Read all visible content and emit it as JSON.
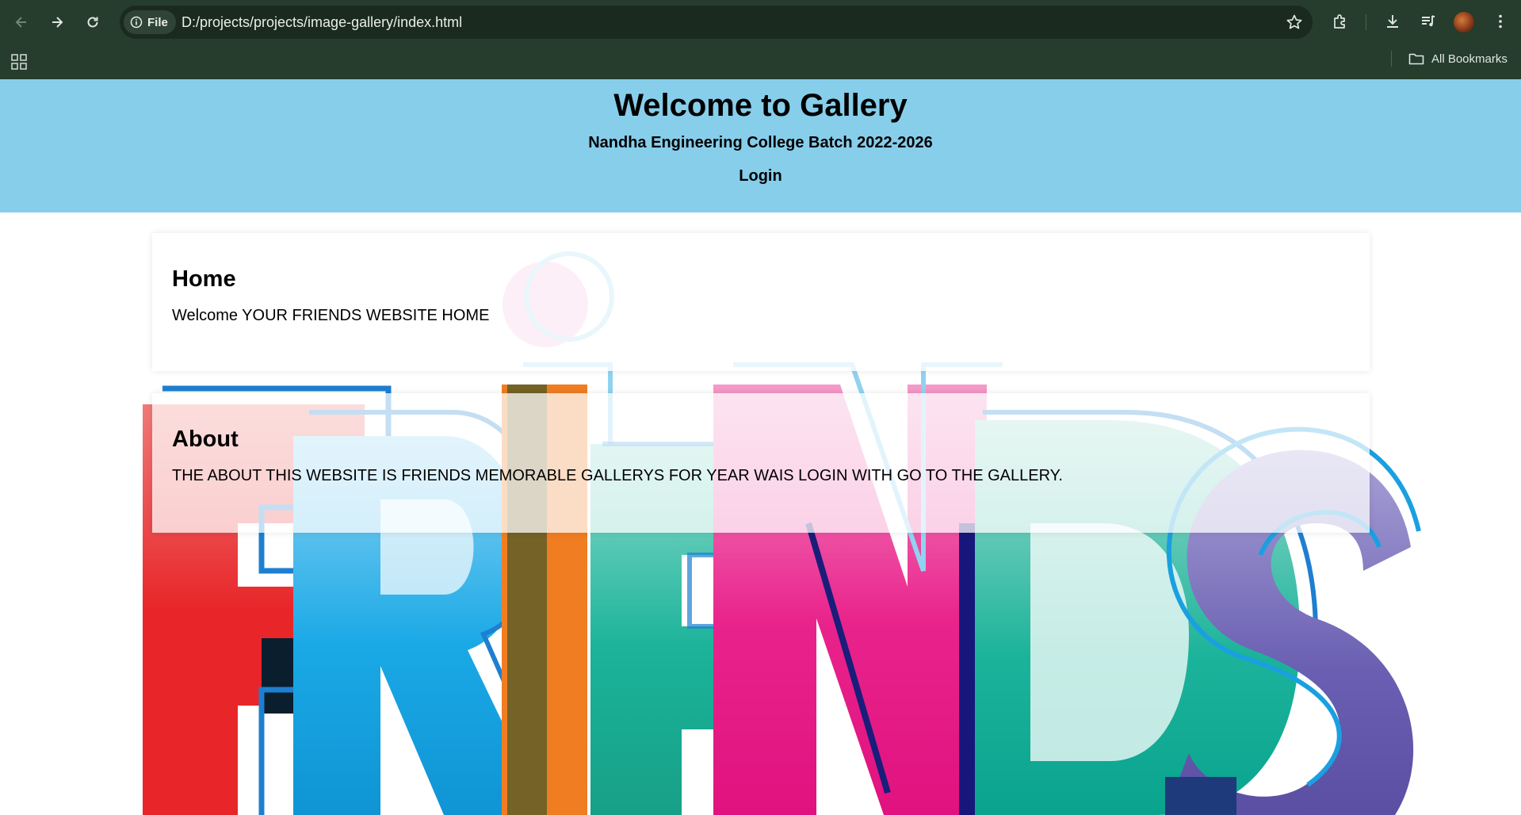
{
  "browser": {
    "url": "D:/projects/projects/image-gallery/index.html",
    "site_chip_label": "File",
    "bookmarks_label": "All Bookmarks",
    "icons": [
      "back-icon",
      "forward-icon",
      "reload-icon",
      "info-icon",
      "star-icon",
      "extensions-icon",
      "download-icon",
      "media-icon",
      "menu-icon",
      "apps-icon",
      "folder-icon"
    ]
  },
  "header": {
    "title": "Welcome to Gallery",
    "subtitle": "Nandha Engineering College Batch 2022-2026",
    "login_label": "Login",
    "background": "#87ceeb"
  },
  "sections": {
    "home": {
      "heading": "Home",
      "text": "Welcome YOUR FRIENDS WEBSITE HOME"
    },
    "about": {
      "heading": "About",
      "text": "THE ABOUT THIS WEBSITE IS FRIENDS MEMORABLE GALLERYS FOR YEAR WAIS LOGIN WITH GO TO THE GALLERY."
    }
  },
  "background_image": {
    "word": "FRIENDS",
    "colors": [
      "#e8262a",
      "#1aa9e6",
      "#f07d22",
      "#1bb39a",
      "#e9238c",
      "#0e6f5f",
      "#5a4fa3"
    ]
  }
}
